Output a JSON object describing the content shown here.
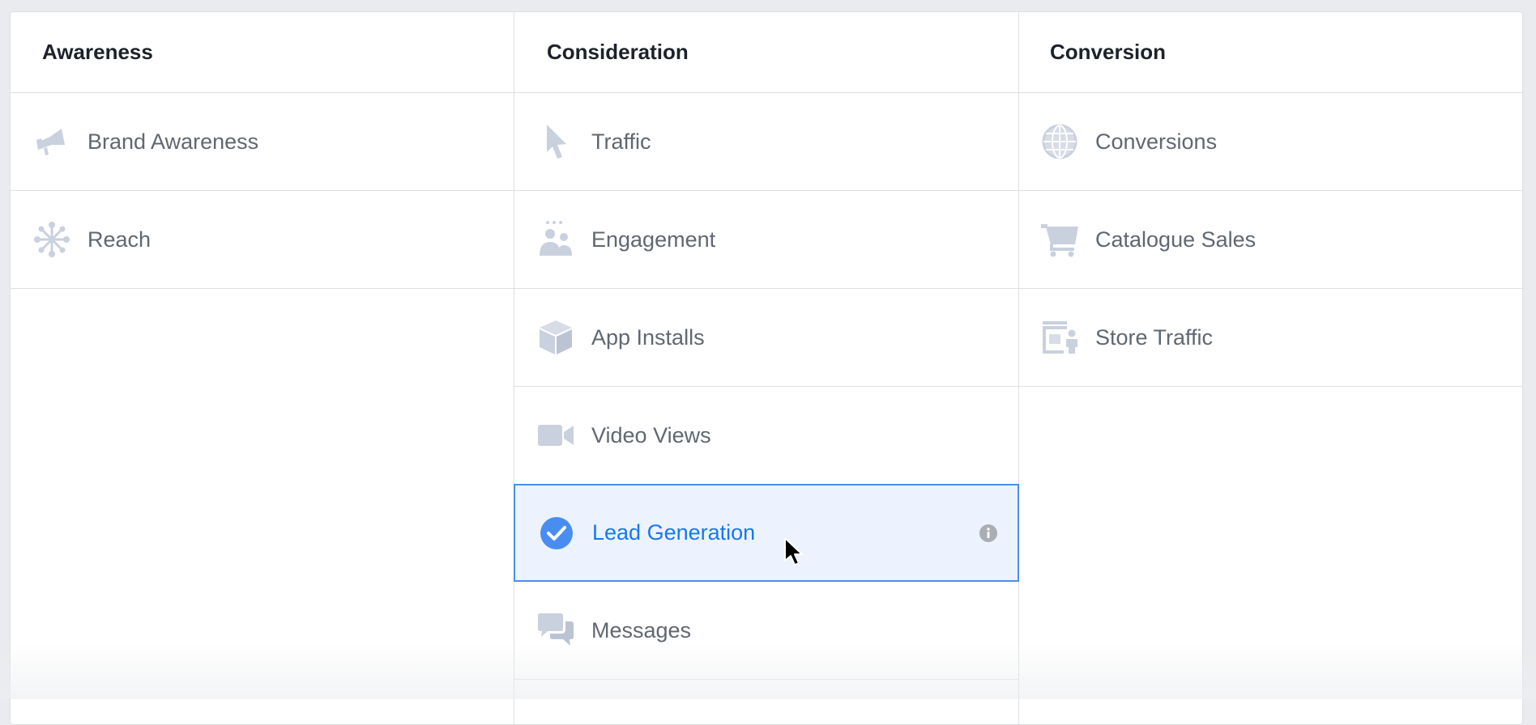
{
  "columns": [
    {
      "header": "Awareness",
      "items": [
        {
          "label": "Brand Awareness",
          "icon": "megaphone-icon"
        },
        {
          "label": "Reach",
          "icon": "reach-icon"
        }
      ]
    },
    {
      "header": "Consideration",
      "items": [
        {
          "label": "Traffic",
          "icon": "cursor-arrow-icon"
        },
        {
          "label": "Engagement",
          "icon": "people-icon"
        },
        {
          "label": "App Installs",
          "icon": "box-icon"
        },
        {
          "label": "Video Views",
          "icon": "video-camera-icon"
        },
        {
          "label": "Lead Generation",
          "icon": "check-circle-icon",
          "selected": true
        },
        {
          "label": "Messages",
          "icon": "chat-bubbles-icon"
        }
      ]
    },
    {
      "header": "Conversion",
      "items": [
        {
          "label": "Conversions",
          "icon": "globe-icon"
        },
        {
          "label": "Catalogue Sales",
          "icon": "shopping-cart-icon"
        },
        {
          "label": "Store Traffic",
          "icon": "store-icon"
        }
      ]
    }
  ],
  "colors": {
    "icon": "#c9d0de",
    "selected_border": "#4a8df0",
    "selected_bg": "#ecf3fe",
    "selected_text": "#1877f2",
    "text": "#606770",
    "header_text": "#1d2129"
  }
}
